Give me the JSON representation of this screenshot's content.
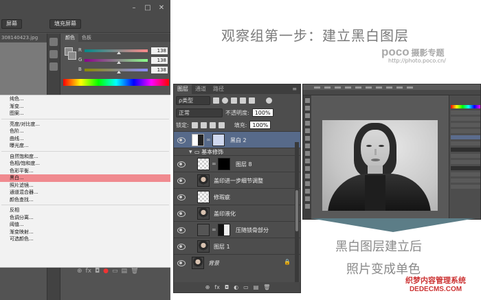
{
  "heading": "观察组第一步：建立黑白图层",
  "brand": {
    "logo": "poco",
    "tag": "摄影专题",
    "url": "http://photo.poco.cn/"
  },
  "left_panel": {
    "window_controls": [
      "–",
      "□",
      "✕"
    ],
    "buttons": [
      "屏幕",
      "填充屏幕"
    ],
    "file_tab": "308140423.jpg",
    "color_panel": {
      "tabs": [
        "颜色",
        "色板"
      ],
      "channels": [
        {
          "label": "R",
          "value": "138",
          "level": 0.54
        },
        {
          "label": "G",
          "value": "138",
          "level": 0.54
        },
        {
          "label": "B",
          "value": "138",
          "level": 0.54
        }
      ]
    },
    "menu_groups": [
      [
        "纯色...",
        "渐变...",
        "图案..."
      ],
      [
        "亮度/对比度...",
        "色阶...",
        "曲线...",
        "曝光度..."
      ],
      [
        "自然饱和度...",
        "色相/饱和度...",
        "色彩平衡...",
        "黑白...",
        "照片滤镜...",
        "通道混合器...",
        "颜色查找..."
      ],
      [
        "反相",
        "色调分离...",
        "阈值...",
        "渐变映射...",
        "可选颜色..."
      ]
    ],
    "highlighted_item": "黑白...",
    "bottom_icons": [
      "⊕",
      "fx",
      "◘",
      "●",
      "▭",
      "▤",
      "🗑"
    ]
  },
  "layers_panel": {
    "tabs": [
      "图层",
      "通道",
      "路径"
    ],
    "filter_label": "ρ类型",
    "blend_mode": "正常",
    "opacity_label": "不透明度:",
    "opacity_value": "100%",
    "lock_label": "锁定:",
    "fill_label": "填充:",
    "fill_value": "100%",
    "layers": [
      {
        "name": "黑白 2",
        "kind": "adjustment",
        "selected": true
      },
      {
        "name": "基本修饰",
        "kind": "group"
      },
      {
        "name": "图层 8",
        "kind": "masked"
      },
      {
        "name": "盖印进一步细节调整",
        "kind": "photo"
      },
      {
        "name": "修瑕疵",
        "kind": "transparent"
      },
      {
        "name": "盖印液化",
        "kind": "photo"
      },
      {
        "name": "压随锁骨部分",
        "kind": "curves"
      },
      {
        "name": "图层 1",
        "kind": "photo"
      },
      {
        "name": "背景",
        "kind": "background"
      }
    ],
    "footer_icons": [
      "⊕",
      "fx",
      "◘",
      "◐",
      "▭",
      "▤",
      "🗑"
    ]
  },
  "captions": [
    "黑白图层建立后",
    "照片变成单色"
  ],
  "watermark": {
    "line1": "织梦内容管理系统",
    "line2": "DEDECMS.COM"
  }
}
